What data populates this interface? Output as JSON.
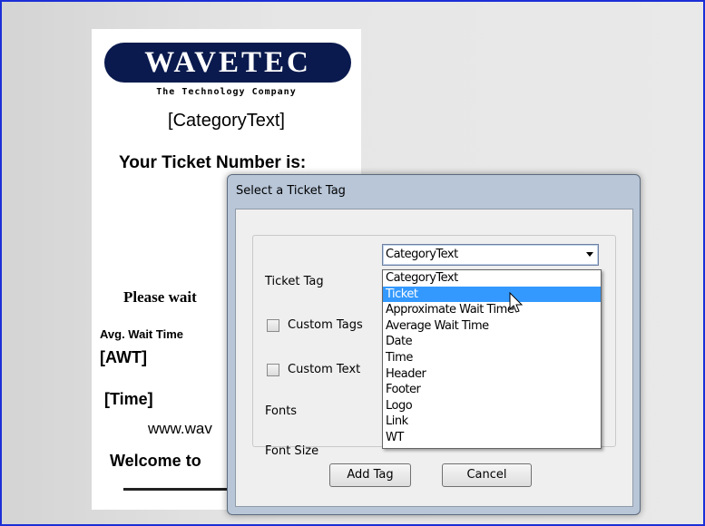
{
  "ticket": {
    "logo_text": "WAVETEC",
    "tagline": "The Technology Company",
    "category_text": "[CategoryText]",
    "your_ticket": "Your Ticket Number is:",
    "please_wait": "Please wait",
    "avg_wait_label": "Avg. Wait Time",
    "awt_tag": "[AWT]",
    "time_tag": "[Time]",
    "website": "www.wav",
    "welcome": "Welcome to"
  },
  "dialog": {
    "title": "Select a Ticket Tag",
    "ticket_tag_label": "Ticket Tag",
    "selected_value": "CategoryText",
    "custom_tags_label": "Custom Tags",
    "custom_text_label": "Custom Text",
    "fonts_label": "Fonts",
    "font_size_label": "Font Size",
    "add_tag_button": "Add Tag",
    "cancel_button": "Cancel",
    "options": [
      "CategoryText",
      "Ticket",
      "Approximate Wait Time",
      "Average Wait Time",
      "Date",
      "Time",
      "Header",
      "Footer",
      "Logo",
      "Link",
      "WT"
    ],
    "highlighted_index": 1
  },
  "colors": {
    "frame_border": "#1b2fd6",
    "logo_bg": "#0a1a4e",
    "highlight": "#3399ff"
  }
}
